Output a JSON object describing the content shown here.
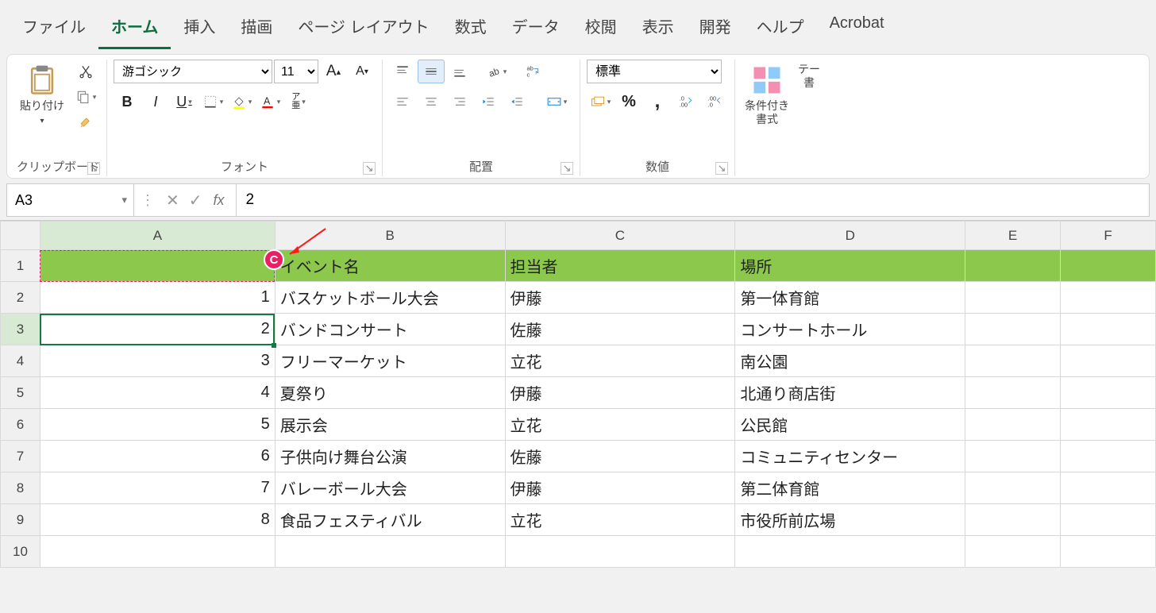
{
  "tabs": [
    "ファイル",
    "ホーム",
    "挿入",
    "描画",
    "ページ レイアウト",
    "数式",
    "データ",
    "校閲",
    "表示",
    "開発",
    "ヘルプ",
    "Acrobat"
  ],
  "active_tab": 1,
  "ribbon": {
    "clipboard": {
      "paste": "貼り付け",
      "label": "クリップボード"
    },
    "font": {
      "name": "游ゴシック",
      "size": "11",
      "label": "フォント"
    },
    "align": {
      "label": "配置"
    },
    "number": {
      "format": "標準",
      "label": "数値"
    },
    "styles": {
      "cf": "条件付き\n書式",
      "tbl": "テー\n書"
    }
  },
  "namebox": "A3",
  "formula": "2",
  "columns": [
    "A",
    "B",
    "C",
    "D",
    "E",
    "F"
  ],
  "rows": [
    {
      "n": 1,
      "header": true,
      "cells": [
        "",
        "イベント名",
        "担当者",
        "場所",
        "",
        ""
      ]
    },
    {
      "n": 2,
      "cells": [
        "1",
        "バスケットボール大会",
        "伊藤",
        "第一体育館",
        "",
        ""
      ]
    },
    {
      "n": 3,
      "cells": [
        "2",
        "バンドコンサート",
        "佐藤",
        "コンサートホール",
        "",
        ""
      ]
    },
    {
      "n": 4,
      "cells": [
        "3",
        "フリーマーケット",
        "立花",
        "南公園",
        "",
        ""
      ]
    },
    {
      "n": 5,
      "cells": [
        "4",
        "夏祭り",
        "伊藤",
        "北通り商店街",
        "",
        ""
      ]
    },
    {
      "n": 6,
      "cells": [
        "5",
        "展示会",
        "立花",
        "公民館",
        "",
        ""
      ]
    },
    {
      "n": 7,
      "cells": [
        "6",
        "子供向け舞台公演",
        "佐藤",
        "コミュニティセンター",
        "",
        ""
      ]
    },
    {
      "n": 8,
      "cells": [
        "7",
        "バレーボール大会",
        "伊藤",
        "第二体育館",
        "",
        ""
      ]
    },
    {
      "n": 9,
      "cells": [
        "8",
        "食品フェスティバル",
        "立花",
        "市役所前広場",
        "",
        ""
      ]
    },
    {
      "n": 10,
      "cells": [
        "",
        "",
        "",
        "",
        "",
        ""
      ]
    }
  ],
  "selected": {
    "row": 3,
    "col": 0
  },
  "marker": "C"
}
